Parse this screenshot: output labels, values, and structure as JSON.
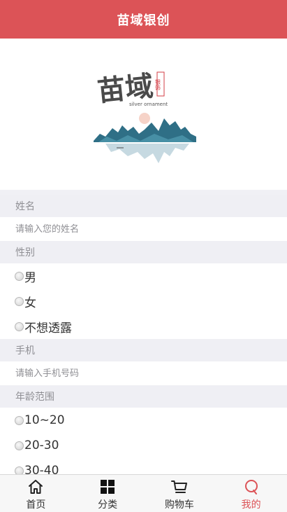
{
  "header": {
    "title": "苗域银创"
  },
  "banner": {
    "logo_text_main": "苗域",
    "logo_text_small": "银饰",
    "logo_subtitle": "silver ornament"
  },
  "form": {
    "name_label": "姓名",
    "name_placeholder": "请输入您的姓名",
    "gender_label": "性别",
    "gender_options": [
      "男",
      "女",
      "不想透露"
    ],
    "phone_label": "手机",
    "phone_placeholder": "请输入手机号码",
    "age_label": "年龄范围",
    "age_options": [
      "10~20",
      "20-30",
      "30-40"
    ]
  },
  "tabbar": {
    "items": [
      {
        "label": "首页",
        "icon": "home-icon"
      },
      {
        "label": "分类",
        "icon": "grid-icon"
      },
      {
        "label": "购物车",
        "icon": "cart-icon"
      },
      {
        "label": "我的",
        "icon": "profile-icon"
      }
    ],
    "active_index": 3
  },
  "colors": {
    "brand": "#dc5357",
    "section_bg": "#efeff4",
    "muted_text": "#8f8f94"
  }
}
